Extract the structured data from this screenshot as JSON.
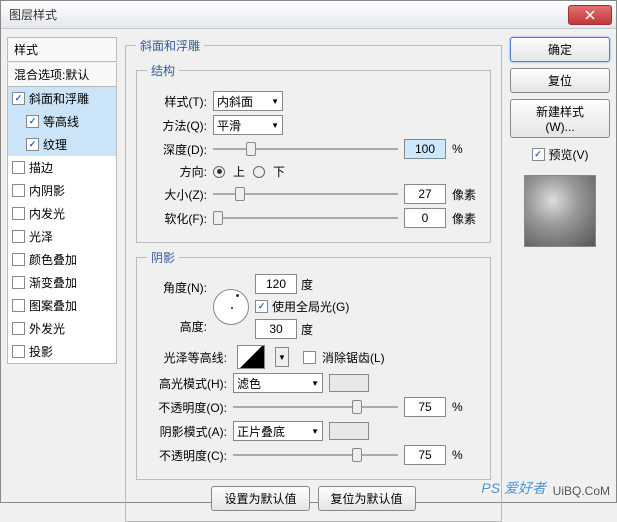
{
  "window": {
    "title": "图层样式"
  },
  "left": {
    "header": "样式",
    "sub": "混合选项:默认",
    "items": [
      {
        "key": "bevel",
        "label": "斜面和浮雕",
        "checked": true,
        "selected": true,
        "indent": false
      },
      {
        "key": "contour",
        "label": "等高线",
        "checked": true,
        "selected": true,
        "indent": true
      },
      {
        "key": "texture",
        "label": "纹理",
        "checked": true,
        "selected": true,
        "indent": true
      },
      {
        "key": "stroke",
        "label": "描边",
        "checked": false,
        "selected": false,
        "indent": false
      },
      {
        "key": "innershadow",
        "label": "内阴影",
        "checked": false,
        "selected": false,
        "indent": false
      },
      {
        "key": "innerglow",
        "label": "内发光",
        "checked": false,
        "selected": false,
        "indent": false
      },
      {
        "key": "satin",
        "label": "光泽",
        "checked": false,
        "selected": false,
        "indent": false
      },
      {
        "key": "coloroverlay",
        "label": "颜色叠加",
        "checked": false,
        "selected": false,
        "indent": false
      },
      {
        "key": "gradientoverlay",
        "label": "渐变叠加",
        "checked": false,
        "selected": false,
        "indent": false
      },
      {
        "key": "patternoverlay",
        "label": "图案叠加",
        "checked": false,
        "selected": false,
        "indent": false
      },
      {
        "key": "outerglow",
        "label": "外发光",
        "checked": false,
        "selected": false,
        "indent": false
      },
      {
        "key": "dropshadow",
        "label": "投影",
        "checked": false,
        "selected": false,
        "indent": false
      }
    ]
  },
  "main": {
    "group_title": "斜面和浮雕",
    "structure": {
      "legend": "结构",
      "style_label": "样式(T):",
      "style_value": "内斜面",
      "method_label": "方法(Q):",
      "method_value": "平滑",
      "depth_label": "深度(D):",
      "depth_value": "100",
      "depth_unit": "%",
      "direction_label": "方向:",
      "up_label": "上",
      "down_label": "下",
      "size_label": "大小(Z):",
      "size_value": "27",
      "size_unit": "像素",
      "soften_label": "软化(F):",
      "soften_value": "0",
      "soften_unit": "像素"
    },
    "shading": {
      "legend": "阴影",
      "angle_label": "角度(N):",
      "angle_value": "120",
      "angle_unit": "度",
      "global_label": "使用全局光(G)",
      "global_checked": true,
      "altitude_label": "高度:",
      "altitude_value": "30",
      "altitude_unit": "度",
      "gloss_label": "光泽等高线:",
      "antialias_label": "消除锯齿(L)",
      "antialias_checked": false,
      "highlight_mode_label": "高光模式(H):",
      "highlight_mode_value": "滤色",
      "highlight_opacity_label": "不透明度(O):",
      "highlight_opacity_value": "75",
      "highlight_opacity_unit": "%",
      "shadow_mode_label": "阴影模式(A):",
      "shadow_mode_value": "正片叠底",
      "shadow_opacity_label": "不透明度(C):",
      "shadow_opacity_value": "75",
      "shadow_opacity_unit": "%"
    },
    "bottom": {
      "set_default": "设置为默认值",
      "reset_default": "复位为默认值"
    }
  },
  "right": {
    "ok": "确定",
    "cancel": "复位",
    "new_style": "新建样式(W)...",
    "preview_label": "预览(V)",
    "preview_checked": true
  },
  "watermark": {
    "t1": "PS 爱好者",
    "t2": "UiBQ.CoM"
  }
}
